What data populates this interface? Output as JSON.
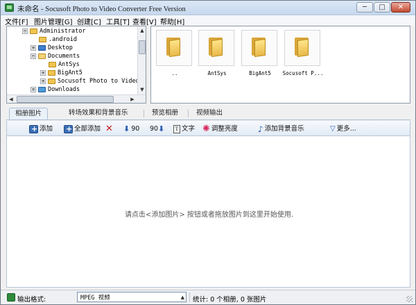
{
  "window": {
    "title": "未命名 - Socusoft Photo to Video Converter Free Version",
    "buttons": {
      "minimize": "─",
      "maximize": "□",
      "close": "✕"
    }
  },
  "menu": [
    "文件[F]",
    "图片管理[G]",
    "创建[C]",
    "工具[T]",
    "查看[V]",
    "帮助[H]"
  ],
  "tree": {
    "items": [
      {
        "label": "Administrator",
        "expander": "⊟",
        "icon": "folder-icon"
      },
      {
        "label": ".android",
        "expander": "",
        "icon": "folder-icon"
      },
      {
        "label": "Desktop",
        "expander": "⊞",
        "icon": "desktop-icon"
      },
      {
        "label": "Documents",
        "expander": "⊟",
        "icon": "folder-icon"
      },
      {
        "label": "AntSys",
        "expander": "",
        "icon": "folder-icon"
      },
      {
        "label": "BigAnt5",
        "expander": "⊞",
        "icon": "folder-icon"
      },
      {
        "label": "Socusoft Photo to Video C",
        "expander": "⊞",
        "icon": "folder-icon"
      },
      {
        "label": "Downloads",
        "expander": "⊞",
        "icon": "download-icon"
      }
    ]
  },
  "folders": [
    {
      "label": ".."
    },
    {
      "label": "AntSys"
    },
    {
      "label": "BigAnt5"
    },
    {
      "label": "Socusoft P..."
    }
  ],
  "tabs": [
    "相册图片",
    "转场效果和背景音乐",
    "预览相册",
    "视频输出"
  ],
  "toolbar": {
    "add": "添加",
    "add_all": "全部添加",
    "rotate_left": "90",
    "rotate_right": "90",
    "text": "文字",
    "brightness": "调整亮度",
    "bg_music": "添加背景音乐",
    "more": "更多..."
  },
  "workarea": {
    "hint": "请点击<添加图片> 按钮或者拖放图片到这里开始使用."
  },
  "status": {
    "format_label": "输出格式:",
    "format_value": "MPEG 视频",
    "stats": "统计: 0 个相册, 0 张图片"
  },
  "colors": {
    "title_bar": "#c6d8ee",
    "folder": "#f0c44f",
    "delete": "#cc1b1b",
    "accent": "#2a5fb0"
  }
}
